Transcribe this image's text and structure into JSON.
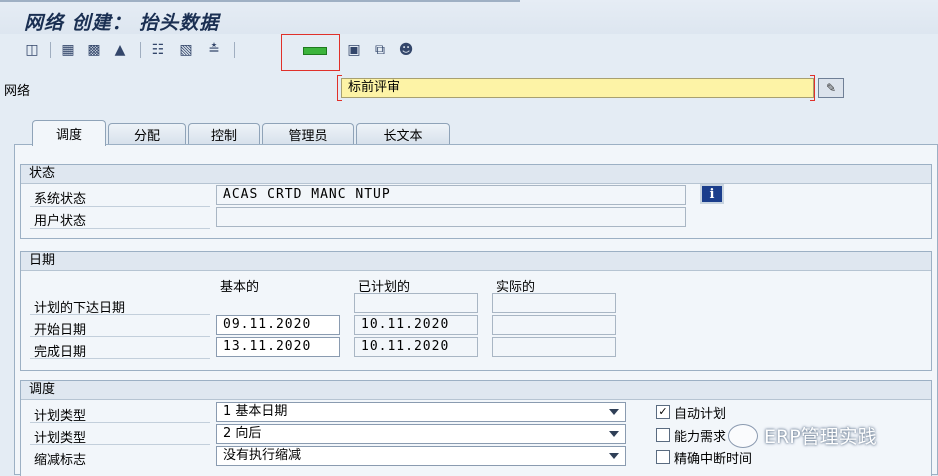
{
  "window": {
    "title": "网络 创建： 抬头数据"
  },
  "header": {
    "network_label": "网络",
    "network_value": "标前评审"
  },
  "tabs": [
    {
      "label": "调度",
      "active": true
    },
    {
      "label": "分配"
    },
    {
      "label": "控制"
    },
    {
      "label": "管理员"
    },
    {
      "label": "长文本"
    }
  ],
  "status": {
    "title": "状态",
    "system_status_label": "系统状态",
    "system_status_value": "ACAS CRTD MANC NTUP",
    "user_status_label": "用户状态",
    "user_status_value": "",
    "info_button": "i"
  },
  "dates": {
    "title": "日期",
    "col_basic": "基本的",
    "col_planned": "已计划的",
    "col_actual": "实际的",
    "rows": [
      {
        "label": "计划的下达日期",
        "basic": "",
        "planned": "",
        "actual": ""
      },
      {
        "label": "开始日期",
        "basic": "09.11.2020",
        "planned": "10.11.2020",
        "actual": ""
      },
      {
        "label": "完成日期",
        "basic": "13.11.2020",
        "planned": "10.11.2020",
        "actual": ""
      }
    ]
  },
  "scheduling": {
    "title": "调度",
    "rows": [
      {
        "label": "计划类型",
        "value": "1 基本日期"
      },
      {
        "label": "计划类型",
        "value": "2 向后"
      },
      {
        "label": "缩减标志",
        "value": "没有执行缩减"
      }
    ],
    "checkboxes": [
      {
        "label": "自动计划",
        "checked": true
      },
      {
        "label": "能力需求",
        "checked": false
      },
      {
        "label": "精确中断时间",
        "checked": false
      }
    ]
  },
  "watermark": "ERP管理实践",
  "colors": {
    "highlight": "#e0302a",
    "required_field": "#fdf3a6",
    "accent": "#1b3e8c"
  }
}
